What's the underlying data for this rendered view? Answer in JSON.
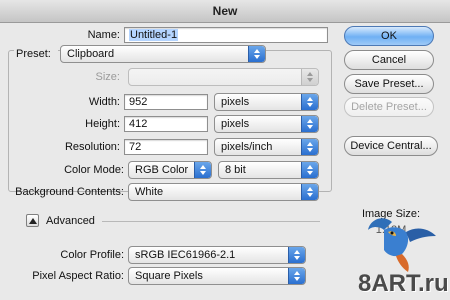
{
  "window": {
    "title": "New"
  },
  "name": {
    "label": "Name:",
    "value": "Untitled-1"
  },
  "preset": {
    "label": "Preset:",
    "value": "Clipboard"
  },
  "size": {
    "label": "Size:",
    "value": ""
  },
  "width": {
    "label": "Width:",
    "value": "952",
    "unit": "pixels"
  },
  "height": {
    "label": "Height:",
    "value": "412",
    "unit": "pixels"
  },
  "resolution": {
    "label": "Resolution:",
    "value": "72",
    "unit": "pixels/inch"
  },
  "color_mode": {
    "label": "Color Mode:",
    "value": "RGB Color",
    "depth": "8 bit"
  },
  "background": {
    "label": "Background Contents:",
    "value": "White"
  },
  "advanced": {
    "label": "Advanced"
  },
  "color_profile": {
    "label": "Color Profile:",
    "value": "sRGB IEC61966-2.1"
  },
  "pixel_aspect": {
    "label": "Pixel Aspect Ratio:",
    "value": "Square Pixels"
  },
  "buttons": {
    "ok": "OK",
    "cancel": "Cancel",
    "save_preset": "Save Preset...",
    "delete_preset": "Delete Preset...",
    "device_central": "Device Central..."
  },
  "image_size": {
    "label": "Image Size:",
    "value": "1.12M"
  },
  "watermark": {
    "text": "8ART.ru"
  },
  "colors": {
    "accent": "#2a6fd0",
    "default_button": "#6fb0f4",
    "background": "#e9e9e9"
  }
}
